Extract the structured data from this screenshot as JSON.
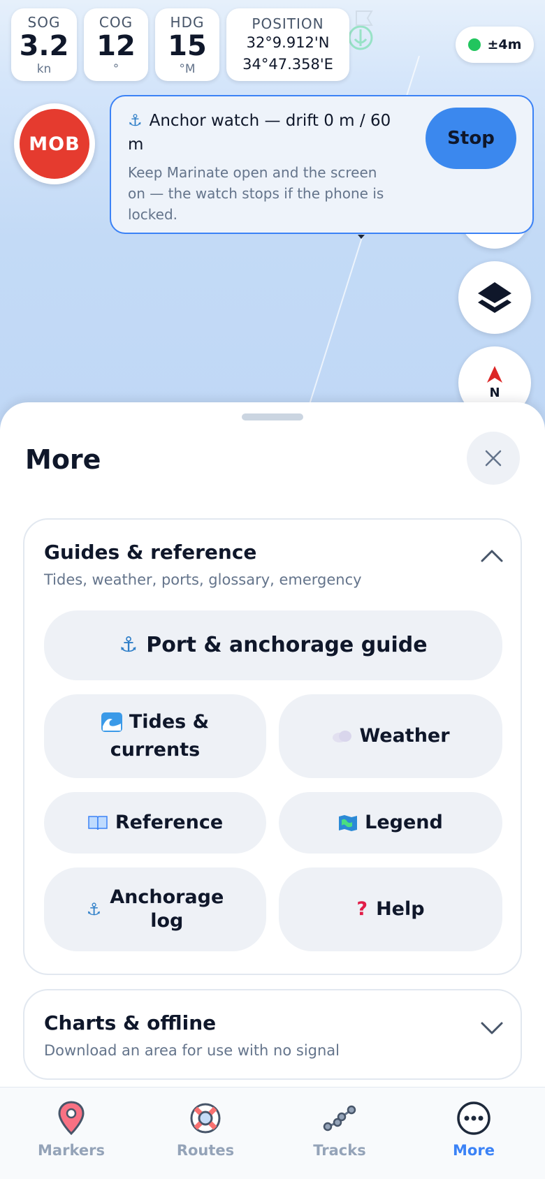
{
  "stats": {
    "sog": {
      "label": "SOG",
      "value": "3.2",
      "unit": "kn"
    },
    "cog": {
      "label": "COG",
      "value": "12",
      "unit": "°"
    },
    "hdg": {
      "label": "HDG",
      "value": "15",
      "unit": "°M"
    },
    "position": {
      "label": "POSITION",
      "lat": "32°9.912'N",
      "lon": "34°47.358'E"
    }
  },
  "gps": {
    "accuracy": "±4m",
    "status_color": "#22c55e"
  },
  "mob": {
    "label": "MOB",
    "color": "#e53b2f"
  },
  "anchor_watch": {
    "icon": "anchor-icon",
    "title": "Anchor watch — drift 0 m / 60 m",
    "description": "Keep Marinate open and the screen on — the watch stops if the phone is locked.",
    "stop_label": "Stop"
  },
  "map_controls": {
    "layers_icon": "layers-icon",
    "compass_label": "N"
  },
  "sheet": {
    "title": "More",
    "close_icon": "close-icon",
    "guides": {
      "title": "Guides & reference",
      "subtitle": "Tides, weather, ports, glossary, emergency",
      "expanded": true,
      "buttons": {
        "port": {
          "icon": "anchor-icon",
          "label": "Port & anchorage guide"
        },
        "tides": {
          "icon": "wave-icon",
          "label_line1": "Tides &",
          "label_line2": "currents"
        },
        "weather": {
          "icon": "cloud-icon",
          "label": "Weather"
        },
        "reference": {
          "icon": "book-icon",
          "label": "Reference"
        },
        "legend": {
          "icon": "map-icon",
          "label": "Legend"
        },
        "anchorage_log": {
          "icon": "anchor-icon",
          "label_line1": "Anchorage",
          "label_line2": "log"
        },
        "help": {
          "icon": "question-icon",
          "label": "Help"
        }
      }
    },
    "charts": {
      "title": "Charts & offline",
      "subtitle": "Download an area for use with no signal",
      "expanded": false
    }
  },
  "tabs": [
    {
      "key": "markers",
      "label": "Markers",
      "icon": "map-pin-icon",
      "active": false
    },
    {
      "key": "routes",
      "label": "Routes",
      "icon": "lifebuoy-icon",
      "active": false
    },
    {
      "key": "tracks",
      "label": "Tracks",
      "icon": "track-icon",
      "active": false
    },
    {
      "key": "more",
      "label": "More",
      "icon": "more-icon",
      "active": true
    }
  ],
  "colors": {
    "accent": "#3b82f6",
    "inactive": "#94a3b8",
    "text": "#0f172a"
  }
}
